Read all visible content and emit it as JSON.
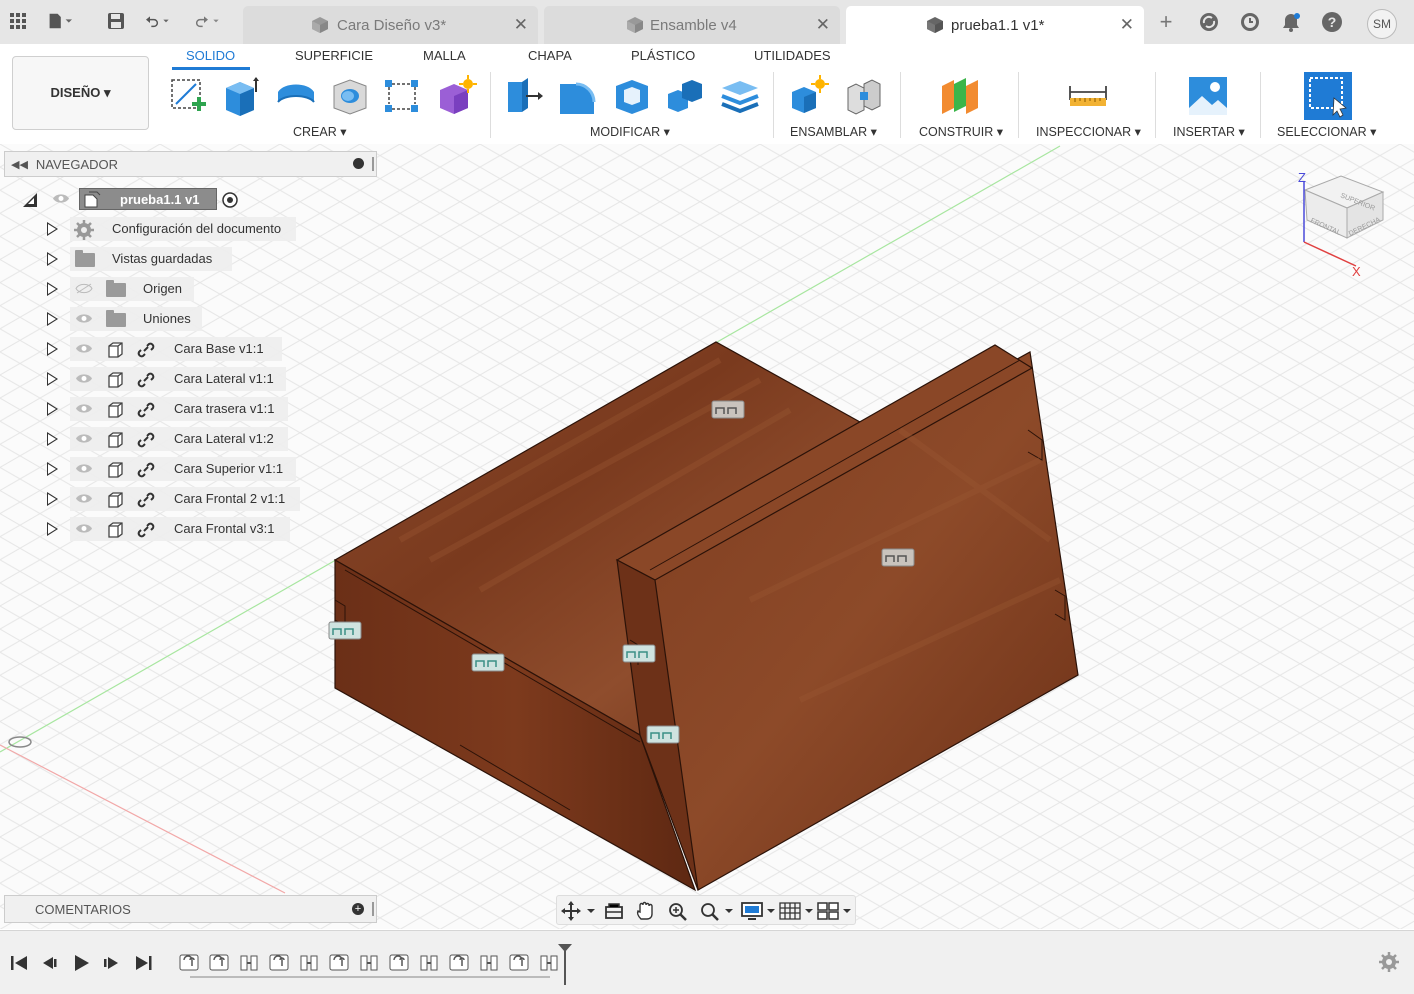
{
  "tabs": [
    {
      "label": "Cara Diseño v3*",
      "active": false
    },
    {
      "label": "Ensamble v4",
      "active": false
    },
    {
      "label": "prueba1.1 v1*",
      "active": true
    }
  ],
  "user_initials": "SM",
  "ribbon": {
    "tabs": [
      "SOLIDO",
      "SUPERFICIE",
      "MALLA",
      "CHAPA",
      "PLÁSTICO",
      "UTILIDADES"
    ],
    "active_tab": "SOLIDO",
    "workspace": "DISEÑO ▾",
    "groups": [
      "CREAR ▾",
      "MODIFICAR ▾",
      "ENSAMBLAR ▾",
      "CONSTRUIR ▾",
      "INSPECCIONAR ▾",
      "INSERTAR ▾",
      "SELECCIONAR ▾"
    ]
  },
  "navigator": {
    "title": "NAVEGADOR",
    "root": "prueba1.1 v1",
    "items": [
      {
        "label": "Configuración del documento",
        "kind": "settings"
      },
      {
        "label": "Vistas guardadas",
        "kind": "folder"
      },
      {
        "label": "Origen",
        "kind": "folder-hidden"
      },
      {
        "label": "Uniones",
        "kind": "folder"
      },
      {
        "label": "Cara Base v1:1",
        "kind": "component"
      },
      {
        "label": "Cara Lateral v1:1",
        "kind": "component"
      },
      {
        "label": "Cara trasera v1:1",
        "kind": "component"
      },
      {
        "label": "Cara Lateral v1:2",
        "kind": "component"
      },
      {
        "label": "Cara Superior v1:1",
        "kind": "component"
      },
      {
        "label": "Cara Frontal 2 v1:1",
        "kind": "component"
      },
      {
        "label": "Cara Frontal v3:1",
        "kind": "component"
      }
    ]
  },
  "comments_label": "COMENTARIOS",
  "viewcube": {
    "top": "SUPERIOR",
    "front": "FRONTAL",
    "right": "DERECHA",
    "axis_z": "Z",
    "axis_x": "X"
  },
  "colors": {
    "accent": "#1f7bd5",
    "wood": "#7a3a1e",
    "wood_dark": "#5a2812"
  },
  "timeline": {
    "feature_count": 13
  }
}
